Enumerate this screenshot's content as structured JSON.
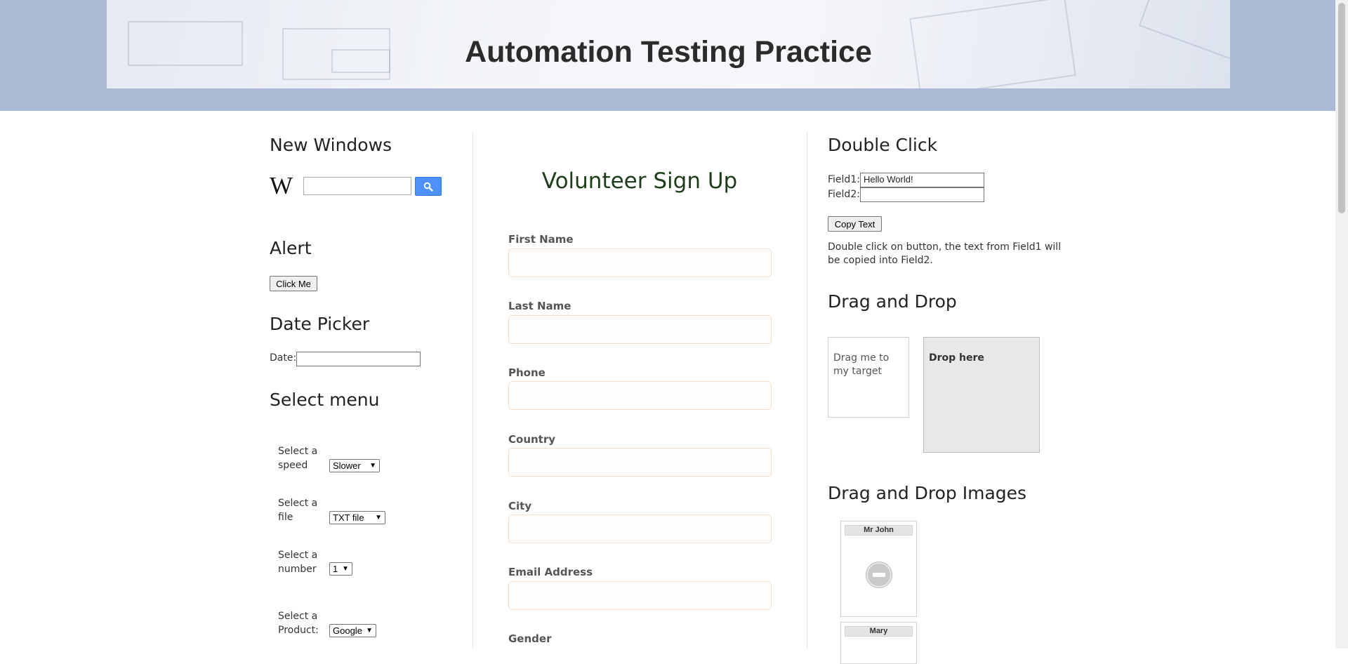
{
  "header": {
    "title": "Automation Testing Practice"
  },
  "left": {
    "new_windows": {
      "heading": "New Windows",
      "logo": "wikipedia-logo",
      "search_icon": "search-icon"
    },
    "alert": {
      "heading": "Alert",
      "button": "Click Me"
    },
    "date_picker": {
      "heading": "Date Picker",
      "label": "Date:"
    },
    "select_menu": {
      "heading": "Select menu",
      "rows": [
        {
          "label": "Select a speed",
          "value": "Slower"
        },
        {
          "label": "Select a file",
          "value": "TXT file"
        },
        {
          "label": "Select a number",
          "value": "1"
        },
        {
          "label": "Select a Product:",
          "value": "Google"
        }
      ]
    }
  },
  "center": {
    "title": "Volunteer Sign Up",
    "fields": [
      "First Name",
      "Last Name",
      "Phone",
      "Country",
      "City",
      "Email Address",
      "Gender"
    ]
  },
  "right": {
    "double_click": {
      "heading": "Double Click",
      "field1_label": "Field1:",
      "field1_value": "Hello World!",
      "field2_label": "Field2:",
      "button": "Copy Text",
      "description": "Double click on button, the text from Field1 will be copied into Field2."
    },
    "drag_drop": {
      "heading": "Drag and Drop",
      "source": "Drag me to my target",
      "target": "Drop here"
    },
    "drag_drop_images": {
      "heading": "Drag and Drop Images",
      "cards": [
        "Mr John",
        "Mary"
      ]
    }
  },
  "colors": {
    "header_band": "#abb9d4",
    "search_button": "#4d90fe",
    "title_green": "#1e3d1a"
  }
}
